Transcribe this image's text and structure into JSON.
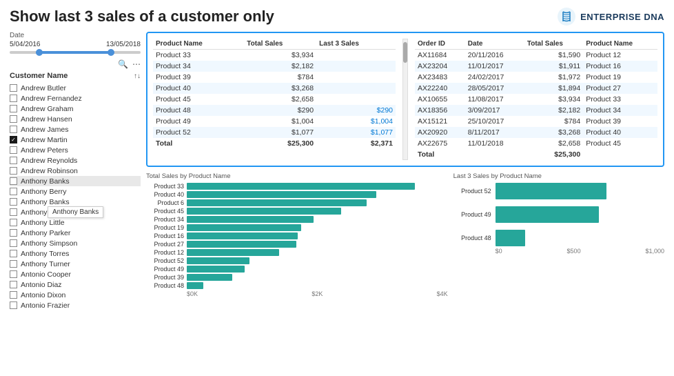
{
  "header": {
    "title": "Show last 3 sales of a customer only",
    "logo_alt": "Enterprise DNA",
    "logo_text": "ENTERPRISE DNA"
  },
  "date_filter": {
    "label": "Date",
    "start": "5/04/2016",
    "end": "13/05/2018"
  },
  "customer_name_label": "Customer Name",
  "customers": [
    {
      "name": "Andrew Butler",
      "checked": false
    },
    {
      "name": "Andrew Fernandez",
      "checked": false
    },
    {
      "name": "Andrew Graham",
      "checked": false
    },
    {
      "name": "Andrew Hansen",
      "checked": false
    },
    {
      "name": "Andrew James",
      "checked": false
    },
    {
      "name": "Andrew Martin",
      "checked": true
    },
    {
      "name": "Andrew Peters",
      "checked": false
    },
    {
      "name": "Andrew Reynolds",
      "checked": false
    },
    {
      "name": "Andrew Robinson",
      "checked": false
    },
    {
      "name": "Anthony Banks",
      "checked": false,
      "hovered": true
    },
    {
      "name": "Anthony Berry",
      "checked": false
    },
    {
      "name": "Anthony Banks",
      "checked": false,
      "tooltip": true
    },
    {
      "name": "Anthony Fisher",
      "checked": false
    },
    {
      "name": "Anthony Little",
      "checked": false
    },
    {
      "name": "Anthony Parker",
      "checked": false
    },
    {
      "name": "Anthony Simpson",
      "checked": false
    },
    {
      "name": "Anthony Torres",
      "checked": false
    },
    {
      "name": "Anthony Turner",
      "checked": false
    },
    {
      "name": "Antonio Cooper",
      "checked": false
    },
    {
      "name": "Antonio Diaz",
      "checked": false
    },
    {
      "name": "Antonio Dixon",
      "checked": false
    },
    {
      "name": "Antonio Frazier",
      "checked": false
    }
  ],
  "left_table": {
    "headers": [
      "Product Name",
      "Total Sales",
      "Last 3 Sales"
    ],
    "rows": [
      {
        "product": "Product 33",
        "total": "$3,934",
        "last3": ""
      },
      {
        "product": "Product 34",
        "total": "$2,182",
        "last3": ""
      },
      {
        "product": "Product 39",
        "total": "$784",
        "last3": ""
      },
      {
        "product": "Product 40",
        "total": "$3,268",
        "last3": ""
      },
      {
        "product": "Product 45",
        "total": "$2,658",
        "last3": ""
      },
      {
        "product": "Product 48",
        "total": "$290",
        "last3": "$290"
      },
      {
        "product": "Product 49",
        "total": "$1,004",
        "last3": "$1,004"
      },
      {
        "product": "Product 52",
        "total": "$1,077",
        "last3": "$1,077"
      }
    ],
    "total_label": "Total",
    "total_sales": "$25,300",
    "total_last3": "$2,371"
  },
  "right_table": {
    "headers": [
      "Order ID",
      "Date",
      "Total Sales",
      "Product Name"
    ],
    "rows": [
      {
        "order": "AX11684",
        "date": "20/11/2016",
        "sales": "$1,590",
        "product": "Product 12"
      },
      {
        "order": "AX23204",
        "date": "11/01/2017",
        "sales": "$1,911",
        "product": "Product 16"
      },
      {
        "order": "AX23483",
        "date": "24/02/2017",
        "sales": "$1,972",
        "product": "Product 19"
      },
      {
        "order": "AX22240",
        "date": "28/05/2017",
        "sales": "$1,894",
        "product": "Product 27"
      },
      {
        "order": "AX10655",
        "date": "11/08/2017",
        "sales": "$3,934",
        "product": "Product 33"
      },
      {
        "order": "AX18356",
        "date": "3/09/2017",
        "sales": "$2,182",
        "product": "Product 34"
      },
      {
        "order": "AX15121",
        "date": "25/10/2017",
        "sales": "$784",
        "product": "Product 39"
      },
      {
        "order": "AX20920",
        "date": "8/11/2017",
        "sales": "$3,268",
        "product": "Product 40"
      },
      {
        "order": "AX22675",
        "date": "11/01/2018",
        "sales": "$2,658",
        "product": "Product 45"
      }
    ],
    "total_label": "Total",
    "total_sales": "$25,300"
  },
  "left_chart": {
    "title": "Total Sales by Product Name",
    "bars": [
      {
        "label": "Product 33",
        "value": 3934,
        "max": 4500
      },
      {
        "label": "Product 40",
        "value": 3268,
        "max": 4500
      },
      {
        "label": "Product 6",
        "value": 3100,
        "max": 4500
      },
      {
        "label": "Product 45",
        "value": 2658,
        "max": 4500
      },
      {
        "label": "Product 34",
        "value": 2182,
        "max": 4500
      },
      {
        "label": "Product 19",
        "value": 1972,
        "max": 4500
      },
      {
        "label": "Product 16",
        "value": 1911,
        "max": 4500
      },
      {
        "label": "Product 27",
        "value": 1894,
        "max": 4500
      },
      {
        "label": "Product 12",
        "value": 1590,
        "max": 4500
      },
      {
        "label": "Product 52",
        "value": 1077,
        "max": 4500
      },
      {
        "label": "Product 49",
        "value": 1004,
        "max": 4500
      },
      {
        "label": "Product 39",
        "value": 784,
        "max": 4500
      },
      {
        "label": "Product 48",
        "value": 290,
        "max": 4500
      }
    ],
    "x_labels": [
      "$0K",
      "$2K",
      "$4K"
    ]
  },
  "right_chart": {
    "title": "Last 3 Sales by Product Name",
    "bars": [
      {
        "label": "Product 52",
        "value": 1077,
        "max": 1200
      },
      {
        "label": "Product 49",
        "value": 1004,
        "max": 1200
      },
      {
        "label": "Product 48",
        "value": 290,
        "max": 1200
      }
    ],
    "x_labels": [
      "$0",
      "$500",
      "$1,000"
    ]
  }
}
